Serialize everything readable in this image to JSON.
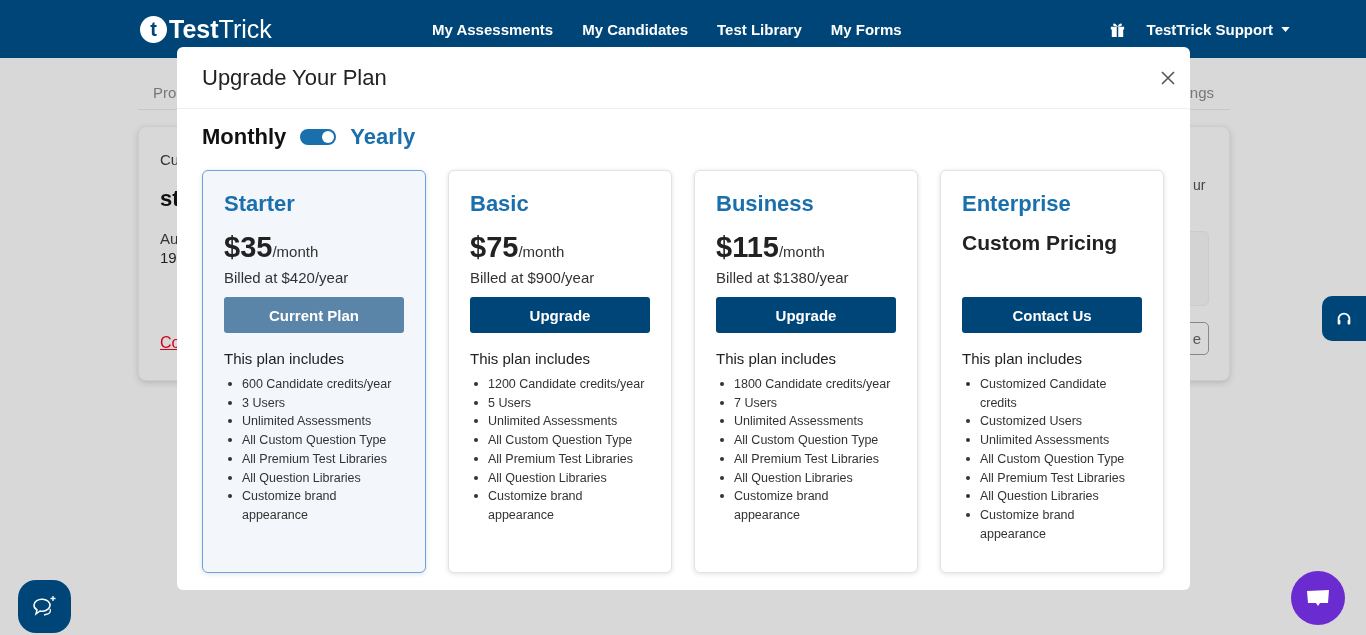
{
  "navbar": {
    "logo_mark": "t",
    "logo": "**Test**Trick",
    "links": [
      {
        "label": "My Assessments"
      },
      {
        "label": "My Candidates"
      },
      {
        "label": "Test Library"
      },
      {
        "label": "My Forms"
      }
    ],
    "account": "TestTrick Support"
  },
  "background": {
    "tab_left": "Pro",
    "tab_right": "ngs",
    "left_texts": [
      {
        "kind": "label",
        "text": "Cu"
      },
      {
        "kind": "value",
        "text": "st"
      },
      {
        "kind": "label",
        "text": "Au"
      },
      {
        "kind": "plain",
        "text": "19"
      },
      {
        "kind": "link",
        "text": "Co"
      }
    ],
    "right_text": "ur",
    "right_button": "e"
  },
  "modal": {
    "title": "Upgrade Your Plan",
    "billing": {
      "monthly": "Monthly",
      "yearly": "Yearly",
      "yearly_on": true
    },
    "plans": [
      {
        "name": "Starter",
        "selected": true,
        "price": "$35",
        "period": "/month",
        "billed": "Billed at $420/year",
        "button": {
          "label": "Current Plan",
          "disabled": true
        },
        "includes": "This plan includes",
        "features": [
          "600 Candidate credits/year",
          "3 Users",
          "Unlimited Assessments",
          "All Custom Question Type",
          "All Premium Test Libraries",
          "All Question Libraries",
          "Customize brand appearance"
        ]
      },
      {
        "name": "Basic",
        "selected": false,
        "price": "$75",
        "period": "/month",
        "billed": "Billed at $900/year",
        "button": {
          "label": "Upgrade",
          "disabled": false
        },
        "includes": "This plan includes",
        "features": [
          "1200 Candidate credits/year",
          "5 Users",
          "Unlimited Assessments",
          "All Custom Question Type",
          "All Premium Test Libraries",
          "All Question Libraries",
          "Customize brand appearance"
        ]
      },
      {
        "name": "Business",
        "selected": false,
        "price": "$115",
        "period": "/month",
        "billed": "Billed at $1380/year",
        "button": {
          "label": "Upgrade",
          "disabled": false
        },
        "includes": "This plan includes",
        "features": [
          "1800 Candidate credits/year",
          "7 Users",
          "Unlimited Assessments",
          "All Custom Question Type",
          "All Premium Test Libraries",
          "All Question Libraries",
          "Customize brand appearance"
        ]
      },
      {
        "name": "Enterprise",
        "selected": false,
        "price": "Custom Pricing",
        "button": {
          "label": "Contact Us",
          "disabled": false
        },
        "includes": "This plan includes",
        "features": [
          "Customized Candidate credits",
          "Customized Users",
          "Unlimited Assessments",
          "All Custom Question Type",
          "All Premium Test Libraries",
          "All Question Libraries",
          "Customize brand appearance"
        ]
      }
    ]
  }
}
